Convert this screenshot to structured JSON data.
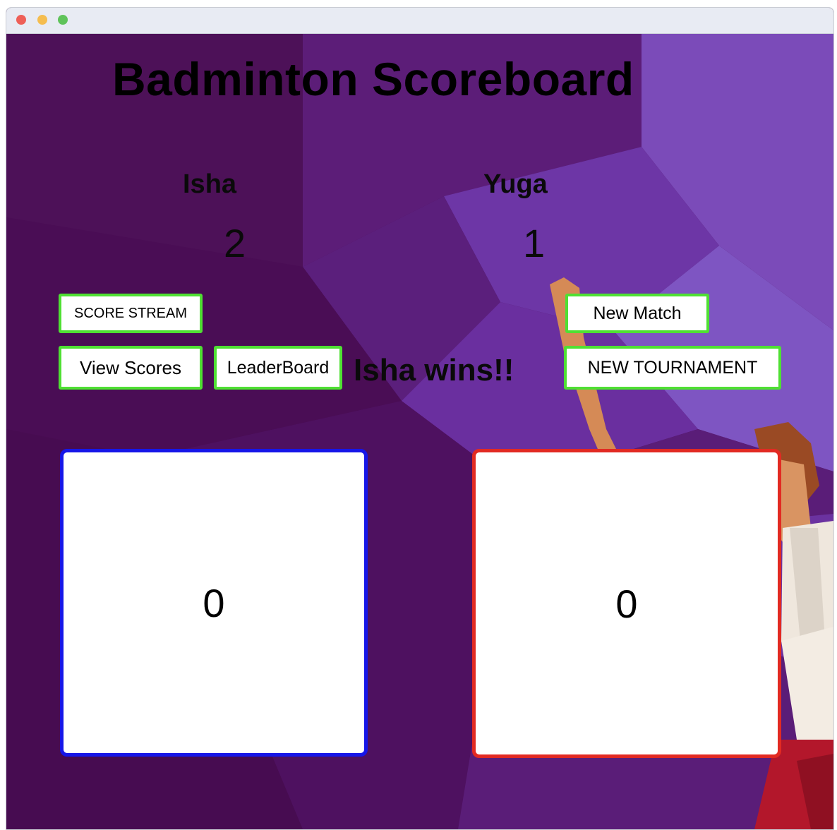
{
  "app": {
    "title": "Badminton Scoreboard"
  },
  "players": [
    {
      "name": "Isha",
      "score": "2"
    },
    {
      "name": "Yuga",
      "score": "1"
    }
  ],
  "buttons": {
    "score_stream": "SCORE STREAM",
    "view_scores": "View Scores",
    "leaderboard": "LeaderBoard",
    "new_match": "New Match",
    "new_tournament": "NEW TOURNAMENT"
  },
  "status": {
    "winner_text": "Isha wins!!"
  },
  "panels": {
    "left_points": "0",
    "right_points": "0"
  },
  "colors": {
    "button_border": "#4fe033",
    "left_panel_border": "#1616e8",
    "right_panel_border": "#e22a22",
    "background": "#4b0f55"
  },
  "icons": {
    "window_controls": [
      "close-dot",
      "minimize-dot",
      "zoom-dot"
    ]
  }
}
